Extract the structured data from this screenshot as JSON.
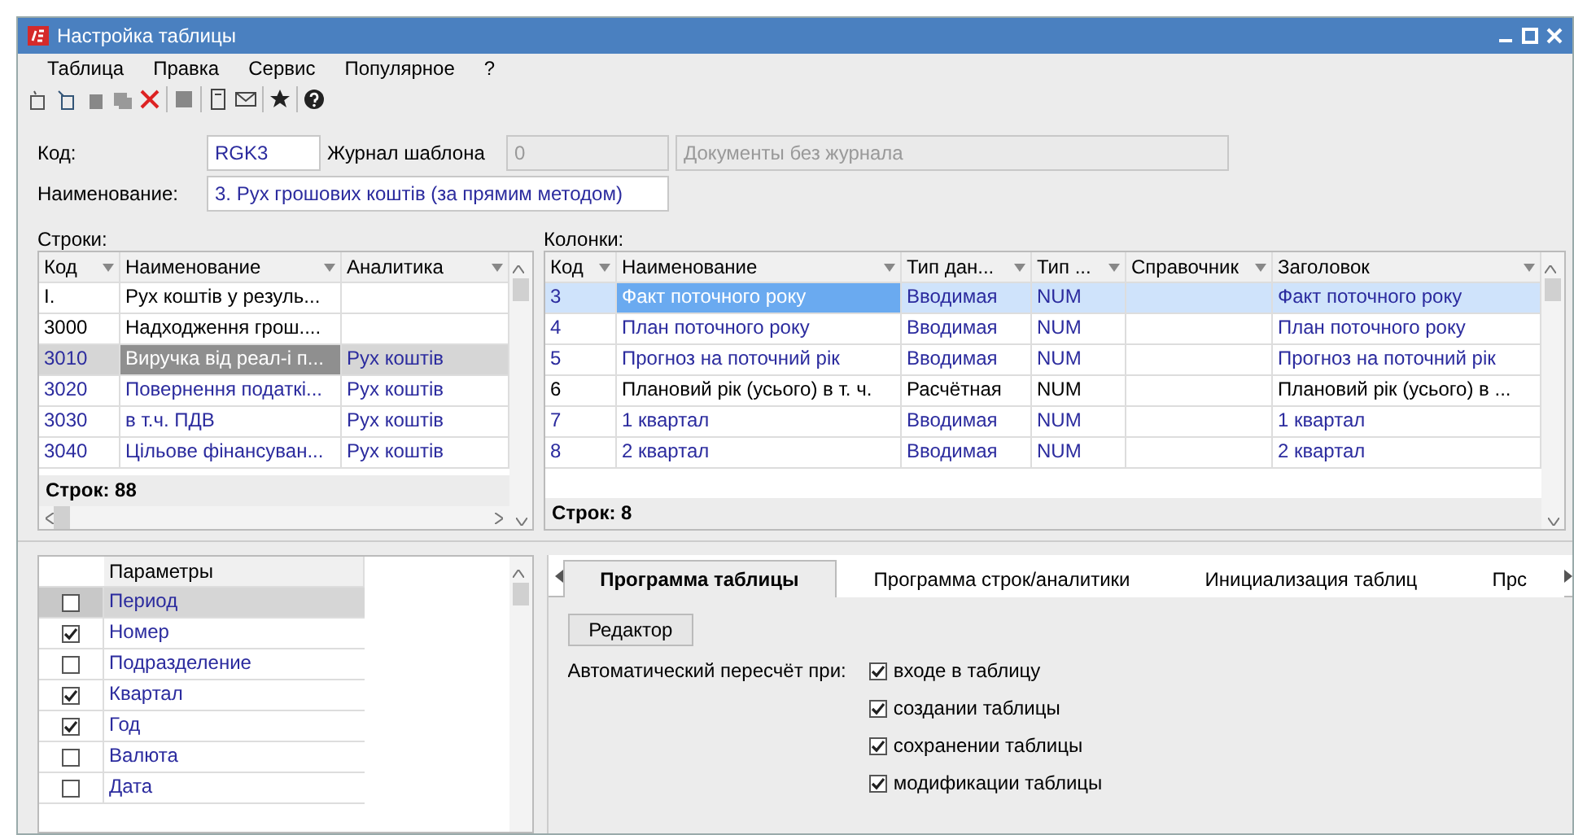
{
  "window": {
    "title": "Настройка таблицы"
  },
  "menu": [
    "Таблица",
    "Правка",
    "Сервис",
    "Популярное",
    "?"
  ],
  "form": {
    "code_label": "Код:",
    "code": "RGK3",
    "journal_label": "Журнал шаблона",
    "journal_code": "0",
    "journal_name": "Документы без журнала",
    "name_label": "Наименование:",
    "name": "3. Рух грошових коштів (за прямим методом)"
  },
  "rows_grid": {
    "label": "Строки:",
    "columns": [
      "Код",
      "Наименование",
      "Аналитика"
    ],
    "rows": [
      {
        "cells": [
          "I.",
          "Рух коштів у резуль...",
          ""
        ],
        "selected": false,
        "color": "#000000"
      },
      {
        "cells": [
          "3000",
          "Надходження грош....",
          ""
        ],
        "selected": false,
        "color": "#000000"
      },
      {
        "cells": [
          "3010",
          "Виручка від реал-і п...",
          "Рух коштів"
        ],
        "selected": true,
        "color": "#2b2b9e"
      },
      {
        "cells": [
          "3020",
          "Повернення податкі...",
          "Рух коштів"
        ],
        "selected": false,
        "color": "#2b2b9e"
      },
      {
        "cells": [
          "3030",
          "в т.ч. ПДВ",
          "Рух коштів"
        ],
        "selected": false,
        "color": "#2b2b9e"
      },
      {
        "cells": [
          "3040",
          "Цільове фінансуван...",
          "Рух коштів"
        ],
        "selected": false,
        "color": "#2b2b9e"
      }
    ],
    "footer": "Строк: 88"
  },
  "columns_grid": {
    "label": "Колонки:",
    "columns": [
      "Код",
      "Наименование",
      "Тип дан...",
      "Тип ...",
      "Справочник",
      "Заголовок"
    ],
    "rows": [
      {
        "cells": [
          "3",
          "Факт поточного року",
          "Вводимая",
          "NUM",
          "",
          "Факт поточного року"
        ],
        "selected": true,
        "color": "#2b2b9e"
      },
      {
        "cells": [
          "4",
          "План поточного року",
          "Вводимая",
          "NUM",
          "",
          "План поточного року"
        ],
        "selected": false,
        "color": "#2b2b9e"
      },
      {
        "cells": [
          "5",
          "Прогноз на поточний рік",
          "Вводимая",
          "NUM",
          "",
          "Прогноз на поточний рік"
        ],
        "selected": false,
        "color": "#2b2b9e"
      },
      {
        "cells": [
          "6",
          "Плановий рік (усього) в т. ч.",
          "Расчётная",
          "NUM",
          "",
          "Плановий рік (усього) в ..."
        ],
        "selected": false,
        "color": "#000000"
      },
      {
        "cells": [
          "7",
          "1 квартал",
          "Вводимая",
          "NUM",
          "",
          "1 квартал"
        ],
        "selected": false,
        "color": "#2b2b9e"
      },
      {
        "cells": [
          "8",
          "2 квартал",
          "Вводимая",
          "NUM",
          "",
          "2 квартал"
        ],
        "selected": false,
        "color": "#2b2b9e"
      }
    ],
    "footer": "Строк: 8"
  },
  "parameters": {
    "header": "Параметры",
    "items": [
      {
        "label": "Период",
        "checked": false,
        "selected": true
      },
      {
        "label": "Номер",
        "checked": true,
        "selected": false
      },
      {
        "label": "Подразделение",
        "checked": false,
        "selected": false
      },
      {
        "label": "Квартал",
        "checked": true,
        "selected": false
      },
      {
        "label": "Год",
        "checked": true,
        "selected": false
      },
      {
        "label": "Валюта",
        "checked": false,
        "selected": false
      },
      {
        "label": "Дата",
        "checked": false,
        "selected": false
      }
    ]
  },
  "tabs": [
    {
      "label": "Программа таблицы",
      "selected": true
    },
    {
      "label": "Программа строк/аналитики",
      "selected": false
    },
    {
      "label": "Инициализация таблиц",
      "selected": false
    },
    {
      "label": "Прс",
      "selected": false
    }
  ],
  "program": {
    "editor_button": "Редактор",
    "recalc_label": "Автоматический пересчёт при:",
    "options": [
      {
        "label": "входе в таблицу",
        "checked": true
      },
      {
        "label": "создании таблицы",
        "checked": true
      },
      {
        "label": "сохранении таблицы",
        "checked": true
      },
      {
        "label": "модификации таблицы",
        "checked": true
      }
    ]
  }
}
